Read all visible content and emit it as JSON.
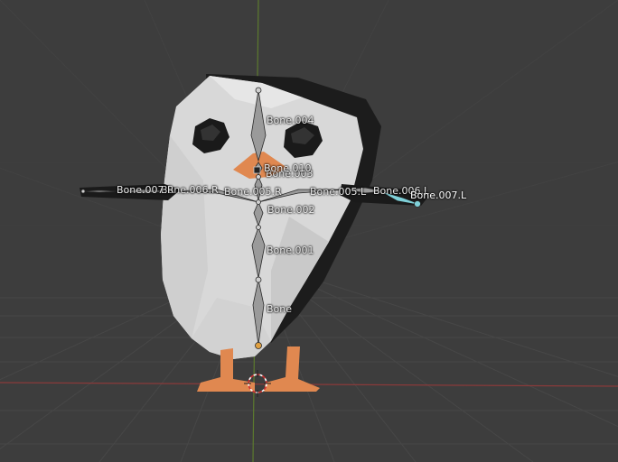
{
  "viewport": {
    "background": "#3d3d3d",
    "grid_color": "#474747",
    "x_axis_color": "#8a3a3a",
    "y_axis_color": "#5c7a2e",
    "bone_color": "#9a9a9a",
    "bone_outline": "#2a2a2a",
    "selected_color": "#7fd0d8"
  },
  "model": {
    "body_color": "#d8d8d8",
    "back_color": "#1c1c1c",
    "beak_color": "#e08850",
    "feet_color": "#e08850",
    "eye_color": "#1a1a1a"
  },
  "bones": [
    {
      "label": "Bone"
    },
    {
      "label": "Bone.001"
    },
    {
      "label": "Bone.002"
    },
    {
      "label": "Bone.003"
    },
    {
      "label": "Bone.004"
    },
    {
      "label": "Bone.010"
    },
    {
      "label": "Bone.005.R"
    },
    {
      "label": "Bone.006.R"
    },
    {
      "label": "Bone.007.R"
    },
    {
      "label": "Bone.005.L"
    },
    {
      "label": "Bone.006.L"
    },
    {
      "label": "Bone.007.L"
    }
  ],
  "cursor_3d": {
    "icon": "3d-cursor-icon"
  }
}
